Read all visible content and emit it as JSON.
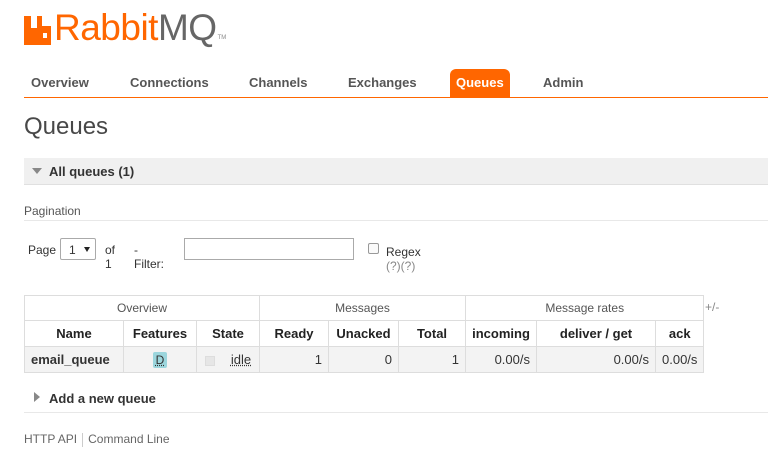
{
  "logo": {
    "rabbit": "Rabbit",
    "mq": "MQ",
    "tm": "TM",
    "brand_color": "#ff6600"
  },
  "nav": {
    "tabs": [
      {
        "label": "Overview",
        "active": false
      },
      {
        "label": "Connections",
        "active": false
      },
      {
        "label": "Channels",
        "active": false
      },
      {
        "label": "Exchanges",
        "active": false
      },
      {
        "label": "Queues",
        "active": true
      },
      {
        "label": "Admin",
        "active": false
      }
    ]
  },
  "page": {
    "title": "Queues"
  },
  "section": {
    "title": "All queues (1)"
  },
  "pagination": {
    "label": "Pagination",
    "page_label": "Page",
    "page_value": "1",
    "of_label": "of 1",
    "filter_label": "- Filter:",
    "filter_value": "",
    "regex_label": "Regex",
    "regex_help": "(?)(?)"
  },
  "table": {
    "groups": [
      "Overview",
      "Messages",
      "Message rates"
    ],
    "columns": [
      "Name",
      "Features",
      "State",
      "Ready",
      "Unacked",
      "Total",
      "incoming",
      "deliver / get",
      "ack"
    ],
    "plus_minus": "+/-",
    "rows": [
      {
        "name": "email_queue",
        "features": "D",
        "state": "idle",
        "ready": "1",
        "unacked": "0",
        "total": "1",
        "incoming": "0.00/s",
        "deliver_get": "0.00/s",
        "ack": "0.00/s"
      }
    ]
  },
  "add_queue": {
    "label": "Add a new queue"
  },
  "footer": {
    "http_api": "HTTP API",
    "command_line": "Command Line"
  },
  "icons": {
    "logo": "rabbit-logo-icon",
    "section_toggle": "triangle-down-icon",
    "add_toggle": "triangle-right-icon"
  }
}
